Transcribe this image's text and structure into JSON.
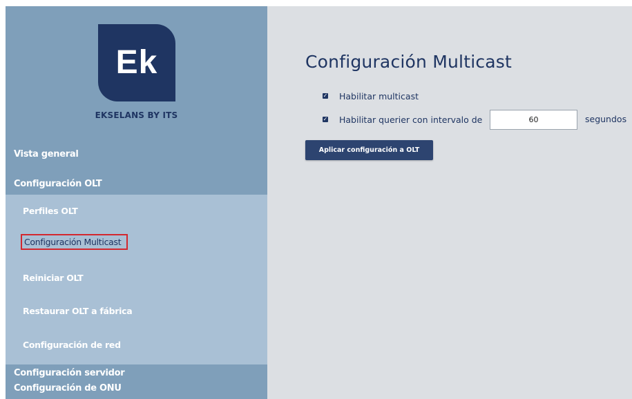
{
  "brand": {
    "logo_text": "Ek",
    "caption": "EKSELANS BY ITS"
  },
  "sidebar": {
    "items": [
      {
        "label": "Vista general"
      },
      {
        "label": "Configuración OLT"
      },
      {
        "label": "Configuración servidor"
      },
      {
        "label": "Configuración de ONU"
      }
    ],
    "submenu": [
      {
        "label": "Perfiles OLT"
      },
      {
        "label": "Configuración Multicast",
        "active": true
      },
      {
        "label": "Reiniciar OLT"
      },
      {
        "label": "Restaurar OLT a fábrica"
      },
      {
        "label": "Configuración de red"
      }
    ]
  },
  "main": {
    "title": "Configuración Multicast",
    "enable_multicast": {
      "label": "Habilitar multicast",
      "checked": true
    },
    "enable_querier": {
      "label": "Habilitar querier con intervalo de",
      "checked": true
    },
    "interval_value": "60",
    "seconds_label": "segundos",
    "apply_button": "Aplicar configuración a OLT"
  },
  "colors": {
    "sidebar_bg": "#7f9fba",
    "submenu_bg": "#a9c0d5",
    "brand_navy": "#1f3562",
    "active_outline": "#d3272e",
    "main_bg": "#dcdfe3"
  }
}
